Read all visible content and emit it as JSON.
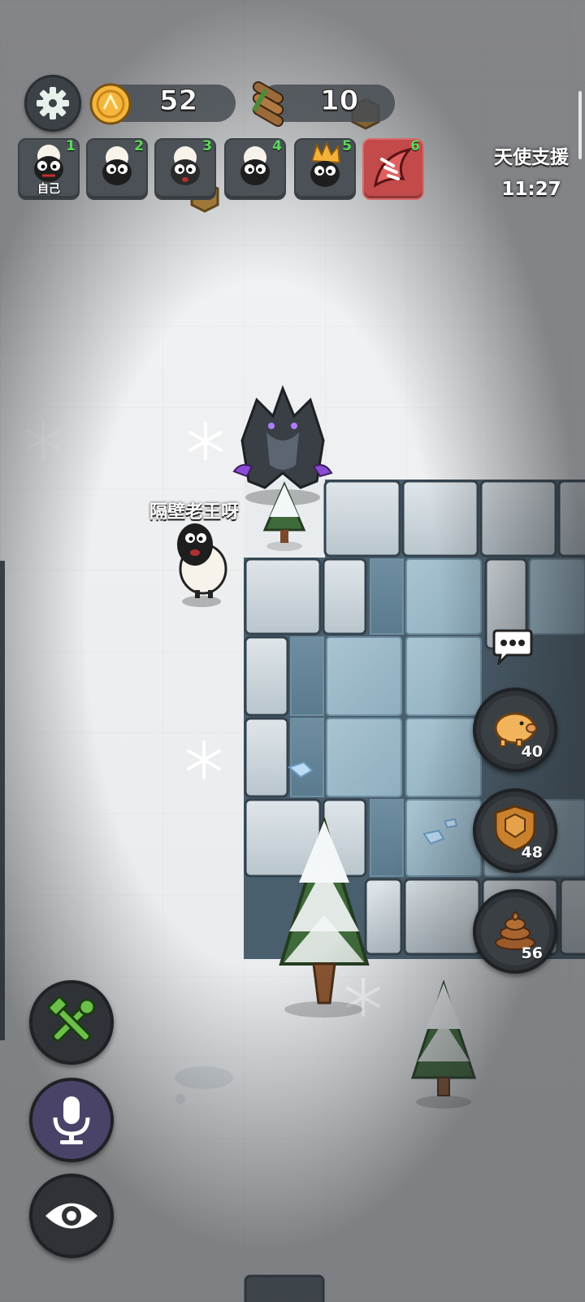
{
  "hud": {
    "coins": "52",
    "wood": "10",
    "settings_icon": "gear-icon",
    "coin_icon": "coin-icon",
    "wood_icon": "wood-logs-icon"
  },
  "players": [
    {
      "num": "1",
      "self_label": "自己",
      "avatar": "sheep-self-icon"
    },
    {
      "num": "2",
      "avatar": "sheep-icon"
    },
    {
      "num": "3",
      "avatar": "sheep-scared-icon"
    },
    {
      "num": "4",
      "avatar": "sheep-icon"
    },
    {
      "num": "5",
      "avatar": "sheep-flame-hair-icon"
    },
    {
      "num": "6",
      "avatar": "wolf-claw-icon",
      "status_color": "#c24a4a"
    }
  ],
  "support": {
    "title": "天使支援",
    "timer": "11:27"
  },
  "world": {
    "player_name": "隔壁老王呀"
  },
  "actions": {
    "piggy": {
      "count": "40",
      "icon": "piggy-bank-icon"
    },
    "shield": {
      "count": "48",
      "icon": "shield-icon"
    },
    "poop": {
      "count": "56",
      "icon": "poop-icon"
    },
    "chat_icon": "chat-bubble-icon",
    "build_icon": "wrench-hammer-icon",
    "mic_icon": "microphone-icon",
    "eye_icon": "eye-icon"
  }
}
